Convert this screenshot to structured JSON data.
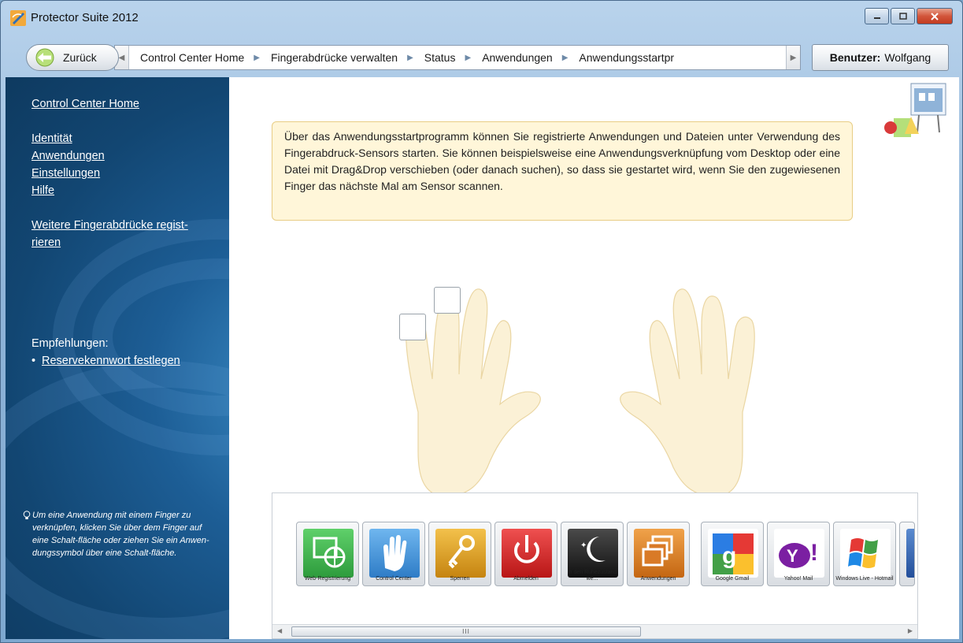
{
  "window": {
    "title": "Protector Suite 2012"
  },
  "nav": {
    "back_label": "Zurück",
    "breadcrumbs": [
      "Control Center Home",
      "Fingerabdrücke verwalten",
      "Status",
      "Anwendungen",
      "Anwendungsstartpr"
    ],
    "user_label": "Benutzer:",
    "user_name": "Wolfgang"
  },
  "sidebar": {
    "home": "Control Center Home",
    "links": [
      "Identität",
      "Anwendungen",
      "Einstellungen",
      "Hilfe"
    ],
    "register_line1": "Weitere Fingerabdrücke regist-",
    "register_line2": "rieren",
    "recommendations_title": "Empfehlungen:",
    "recommendation": "Reservekennwort festlegen",
    "tip": "Um eine Anwendung mit einem Finger zu verknüpfen, klicken Sie über dem Finger auf eine Schalt-fläche oder ziehen Sie ein Anwen-dungssymbol über eine Schalt-fläche."
  },
  "main": {
    "info": "Über das Anwendungsstartprogramm können Sie registrierte Anwendungen und Dateien unter Verwendung des Fingerabdruck-Sensors starten. Sie können beispielsweise eine Anwendungsverknüpfung vom Desktop oder eine Datei mit Drag&Drop verschieben (oder danach suchen), so dass sie gestartet wird, wenn Sie den zugewiesenen Finger das nächste Mal am Sensor scannen."
  },
  "apps": [
    {
      "label": "Web-Registrierung",
      "icon": "globe-icon",
      "color": "#36b24a"
    },
    {
      "label": "Control Center",
      "icon": "hand-icon",
      "color": "#3a8fd6"
    },
    {
      "label": "Sperren",
      "icon": "key-icon",
      "color": "#e0a21e"
    },
    {
      "label": "Abmelden",
      "icon": "power-icon",
      "color": "#d42a2a"
    },
    {
      "label": "In den Ruhezustand we...",
      "icon": "moon-icon",
      "color": "#2a2a2a"
    },
    {
      "label": "Anwendungen",
      "icon": "windows-stack-icon",
      "color": "#e08a2a"
    },
    {
      "label": "Google Gmail",
      "icon": "google-icon",
      "color": "#ffffff"
    },
    {
      "label": "Yahoo! Mail",
      "icon": "yahoo-icon",
      "color": "#ffffff"
    },
    {
      "label": "Windows Live - Hotmail",
      "icon": "windows-flag-icon",
      "color": "#ffffff"
    }
  ],
  "scrollbar": {
    "grip": "III"
  }
}
